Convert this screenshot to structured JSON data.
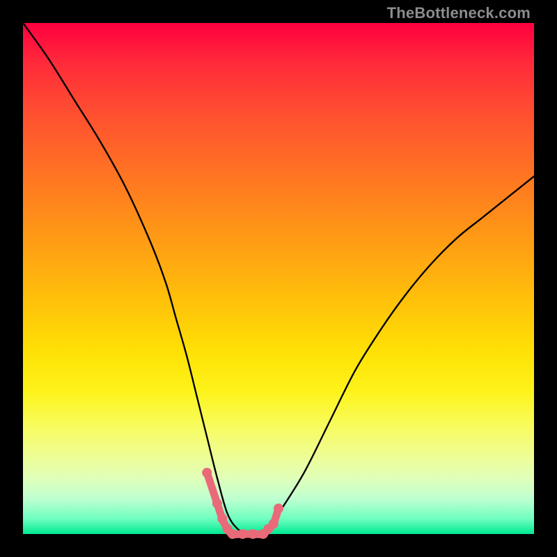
{
  "watermark": "TheBottleneck.com",
  "chart_data": {
    "type": "line",
    "title": "",
    "xlabel": "",
    "ylabel": "",
    "xlim": [
      0,
      100
    ],
    "ylim": [
      0,
      100
    ],
    "grid": false,
    "legend": false,
    "series": [
      {
        "name": "bottleneck-curve",
        "color": "#000000",
        "x": [
          0,
          5,
          10,
          15,
          20,
          25,
          28,
          30,
          32,
          34,
          36,
          38,
          40,
          42,
          44,
          46,
          48,
          50,
          55,
          60,
          65,
          70,
          75,
          80,
          85,
          90,
          95,
          100
        ],
        "y": [
          100,
          93,
          85,
          77,
          68,
          57,
          49,
          42,
          35,
          27,
          19,
          11,
          4,
          1,
          0,
          0,
          1,
          4,
          12,
          22,
          32,
          40,
          47,
          53,
          58,
          62,
          66,
          70
        ]
      },
      {
        "name": "valley-highlight-dots",
        "color": "#e96a78",
        "x": [
          36,
          38,
          39,
          40,
          41,
          43,
          45,
          47,
          48,
          49,
          50
        ],
        "y": [
          12,
          6,
          3,
          1,
          0,
          0,
          0,
          0,
          1,
          2,
          5
        ]
      }
    ],
    "annotations": []
  }
}
